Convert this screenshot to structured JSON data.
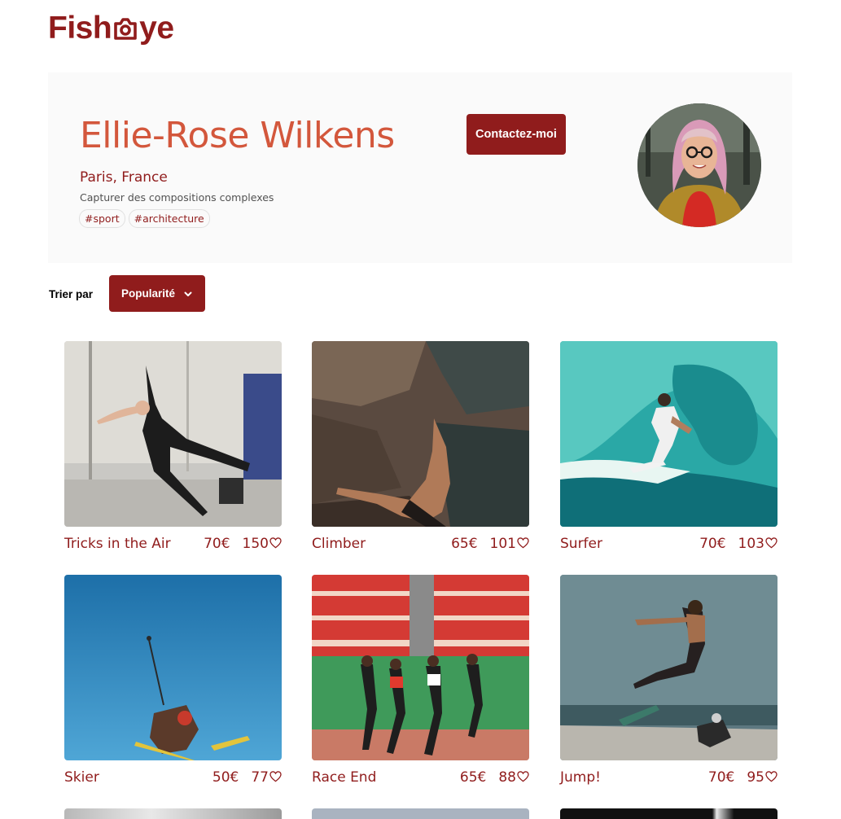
{
  "brand": {
    "logo_text_left": "Fish",
    "logo_text_right": "ye",
    "logo_icon": "camera-icon"
  },
  "colors": {
    "primary": "#901C1C",
    "name_accent": "#D3573C",
    "header_bg": "#FAFAFA",
    "tagline": "#525252"
  },
  "photographer": {
    "name": "Ellie-Rose Wilkens",
    "location": "Paris, France",
    "tagline": "Capturer des compositions complexes",
    "tags": [
      "#sport",
      "#architecture"
    ],
    "contact_label": "Contactez-moi"
  },
  "sort": {
    "label": "Trier par",
    "selected": "Popularité",
    "icon": "chevron-down-icon"
  },
  "media": [
    {
      "title": "Tricks in the Air",
      "price": "70€",
      "likes": "150"
    },
    {
      "title": "Climber",
      "price": "65€",
      "likes": "101"
    },
    {
      "title": "Surfer",
      "price": "70€",
      "likes": "103"
    },
    {
      "title": "Skier",
      "price": "50€",
      "likes": "77"
    },
    {
      "title": "Race End",
      "price": "65€",
      "likes": "88"
    },
    {
      "title": "Jump!",
      "price": "70€",
      "likes": "95"
    }
  ]
}
